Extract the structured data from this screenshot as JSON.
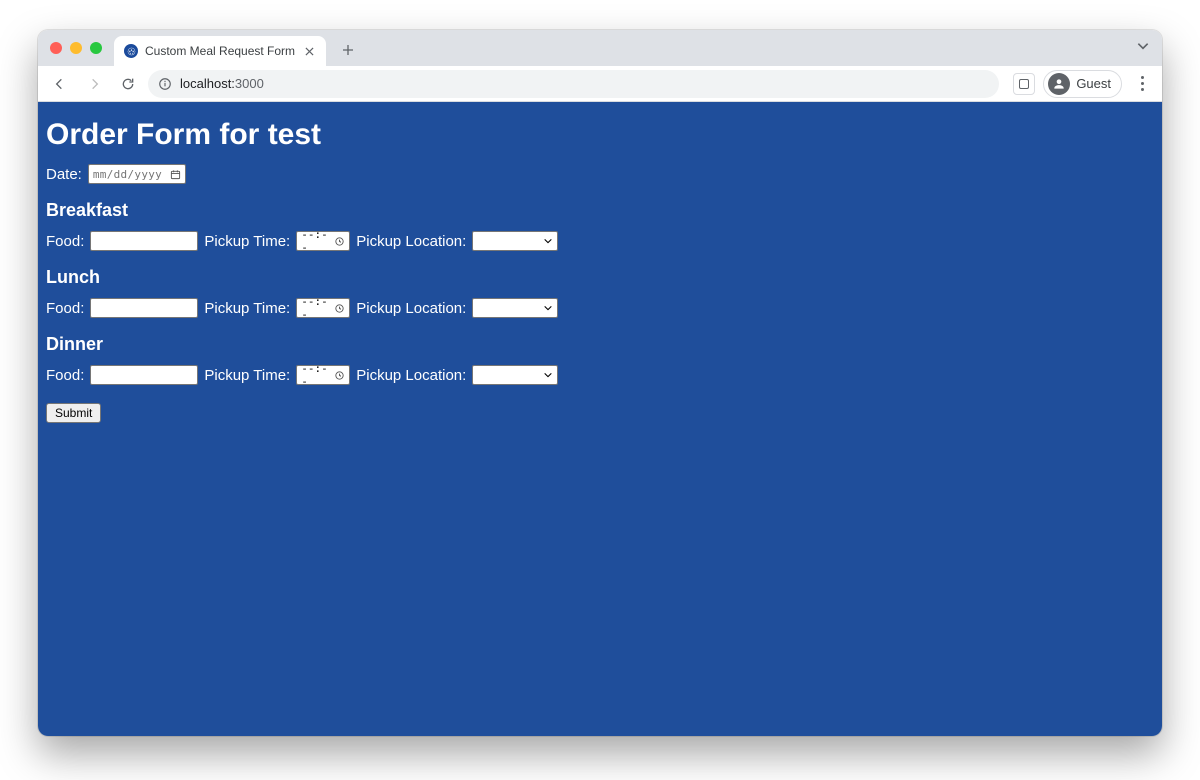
{
  "browser": {
    "tab_title": "Custom Meal Request Form",
    "url_host": "localhost:",
    "url_port": "3000",
    "profile_label": "Guest"
  },
  "page": {
    "heading": "Order Form for test",
    "date_label": "Date:",
    "date_placeholder": "mm/dd/yyyy",
    "food_label": "Food:",
    "pickup_time_label": "Pickup Time:",
    "time_placeholder": "--:--",
    "pickup_location_label": "Pickup Location:",
    "submit_label": "Submit",
    "meals": {
      "breakfast": {
        "heading": "Breakfast"
      },
      "lunch": {
        "heading": "Lunch"
      },
      "dinner": {
        "heading": "Dinner"
      }
    }
  }
}
